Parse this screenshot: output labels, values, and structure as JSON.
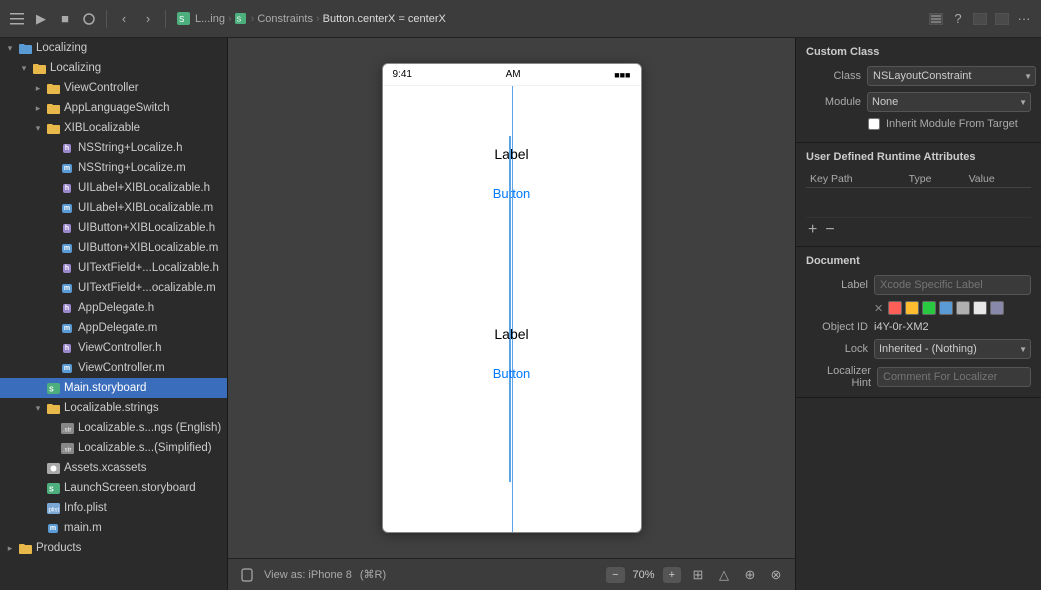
{
  "toolbar": {
    "breadcrumb": [
      {
        "label": "L...ing",
        "active": false
      },
      {
        "label": ">",
        "sep": true
      },
      {
        "label": "Main.storyboard icon",
        "active": false
      },
      {
        "label": ">",
        "sep": true
      },
      {
        "label": "Constraints",
        "active": false
      },
      {
        "label": ">",
        "sep": true
      },
      {
        "label": "Button.centerX = centerX",
        "active": true
      }
    ],
    "nav_back": "‹",
    "nav_forward": "›"
  },
  "sidebar": {
    "items": [
      {
        "id": "localizing-root",
        "label": "Localizing",
        "indent": 0,
        "type": "folder-blue",
        "expanded": true,
        "arrow": "expanded"
      },
      {
        "id": "localizing-sub",
        "label": "Localizing",
        "indent": 1,
        "type": "folder-yellow",
        "expanded": true,
        "arrow": "expanded"
      },
      {
        "id": "viewcontroller",
        "label": "ViewController",
        "indent": 2,
        "type": "folder-yellow",
        "expanded": false,
        "arrow": "collapsed"
      },
      {
        "id": "applanguageswitch",
        "label": "AppLanguageSwitch",
        "indent": 2,
        "type": "folder-yellow",
        "expanded": false,
        "arrow": "collapsed"
      },
      {
        "id": "xiblocalizable",
        "label": "XIBLocalizable",
        "indent": 2,
        "type": "folder-yellow",
        "expanded": true,
        "arrow": "expanded"
      },
      {
        "id": "nsstring-h",
        "label": "NSString+Localize.h",
        "indent": 3,
        "type": "h",
        "arrow": "leaf"
      },
      {
        "id": "nsstring-m",
        "label": "NSString+Localize.m",
        "indent": 3,
        "type": "m",
        "arrow": "leaf"
      },
      {
        "id": "uilabel-h",
        "label": "UILabel+XIBLocalizable.h",
        "indent": 3,
        "type": "h",
        "arrow": "leaf"
      },
      {
        "id": "uilabel-m",
        "label": "UILabel+XIBLocalizable.m",
        "indent": 3,
        "type": "m",
        "arrow": "leaf"
      },
      {
        "id": "uibutton-h",
        "label": "UIButton+XIBLocalizable.h",
        "indent": 3,
        "type": "h",
        "arrow": "leaf"
      },
      {
        "id": "uibutton-m",
        "label": "UIButton+XIBLocalizable.m",
        "indent": 3,
        "type": "m",
        "arrow": "leaf"
      },
      {
        "id": "uitextfield-h",
        "label": "UITextField+...Localizable.h",
        "indent": 3,
        "type": "h",
        "arrow": "leaf"
      },
      {
        "id": "uitextfield-m",
        "label": "UITextField+...ocalizable.m",
        "indent": 3,
        "type": "m",
        "arrow": "leaf"
      },
      {
        "id": "appdelegate-h",
        "label": "AppDelegate.h",
        "indent": 3,
        "type": "h",
        "arrow": "leaf"
      },
      {
        "id": "appdelegate-m",
        "label": "AppDelegate.m",
        "indent": 3,
        "type": "m",
        "arrow": "leaf"
      },
      {
        "id": "viewcontroller-h",
        "label": "ViewController.h",
        "indent": 3,
        "type": "h",
        "arrow": "leaf"
      },
      {
        "id": "viewcontroller-m",
        "label": "ViewController.m",
        "indent": 3,
        "type": "m",
        "arrow": "leaf"
      },
      {
        "id": "main-storyboard",
        "label": "Main.storyboard",
        "indent": 2,
        "type": "storyboard",
        "arrow": "leaf",
        "selected": true
      },
      {
        "id": "localizable-strings",
        "label": "Localizable.strings",
        "indent": 2,
        "type": "folder-yellow",
        "expanded": true,
        "arrow": "expanded"
      },
      {
        "id": "localizable-english",
        "label": "Localizable.s...ngs (English)",
        "indent": 3,
        "type": "strings",
        "arrow": "leaf"
      },
      {
        "id": "localizable-simplified",
        "label": "Localizable.s...(Simplified)",
        "indent": 3,
        "type": "strings",
        "arrow": "leaf"
      },
      {
        "id": "assets",
        "label": "Assets.xcassets",
        "indent": 2,
        "type": "xcassets",
        "arrow": "leaf"
      },
      {
        "id": "launchscreen",
        "label": "LaunchScreen.storyboard",
        "indent": 2,
        "type": "storyboard",
        "arrow": "leaf"
      },
      {
        "id": "infoplist",
        "label": "Info.plist",
        "indent": 2,
        "type": "plist",
        "arrow": "leaf"
      },
      {
        "id": "main-m",
        "label": "main.m",
        "indent": 2,
        "type": "m",
        "arrow": "leaf"
      },
      {
        "id": "products",
        "label": "Products",
        "indent": 0,
        "type": "folder-yellow",
        "expanded": false,
        "arrow": "collapsed"
      }
    ]
  },
  "canvas": {
    "phone": {
      "status_time": "9:41",
      "status_am": "AM",
      "label1": "Label",
      "button1": "Button",
      "label2": "Label",
      "button2": "Button"
    },
    "view_as": "View as: iPhone 8",
    "shortcut": "(⌘R)",
    "zoom": "70%"
  },
  "right_panel": {
    "custom_class": {
      "title": "Custom Class",
      "class_label": "Class",
      "class_value": "NSLayoutConstraint",
      "module_label": "Module",
      "module_value": "None",
      "inherit_label": "Inherit Module From Target"
    },
    "runtime_attributes": {
      "title": "User Defined Runtime Attributes",
      "columns": [
        "Key Path",
        "Type",
        "Value"
      ],
      "rows": []
    },
    "document": {
      "title": "Document",
      "label_label": "Label",
      "label_placeholder": "Xcode Specific Label",
      "colors": [
        "#ff5f57",
        "#febc2e",
        "#28c840",
        "#5b9bd5",
        "#b0b0b0",
        "#e8e8e8",
        "#8888aa"
      ],
      "object_id_label": "Object ID",
      "object_id_value": "i4Y-0r-XM2",
      "lock_label": "Lock",
      "lock_value": "Inherited - (Nothing)",
      "localizer_label": "Localizer Hint",
      "localizer_placeholder": "Comment For Localizer"
    }
  }
}
